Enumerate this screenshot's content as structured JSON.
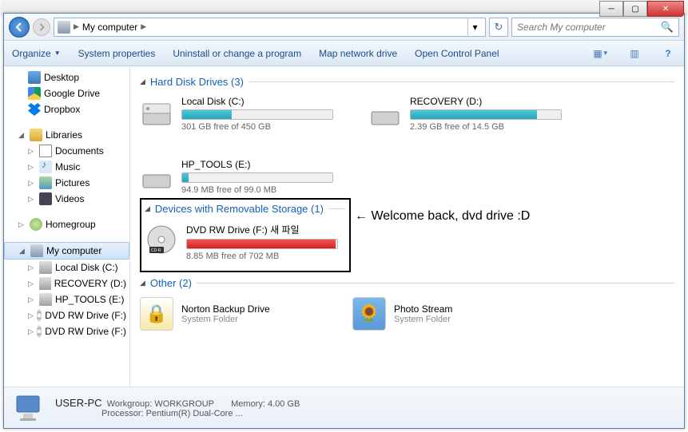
{
  "breadcrumb": {
    "location": "My computer"
  },
  "search": {
    "placeholder": "Search My computer"
  },
  "toolbar": {
    "organize": "Organize",
    "sysprops": "System properties",
    "uninstall": "Uninstall or change a program",
    "mapdrive": "Map network drive",
    "controlpanel": "Open Control Panel"
  },
  "sidebar": {
    "desktop": "Desktop",
    "gdrive": "Google Drive",
    "dropbox": "Dropbox",
    "libraries": "Libraries",
    "documents": "Documents",
    "music": "Music",
    "pictures": "Pictures",
    "videos": "Videos",
    "homegroup": "Homegroup",
    "mycomputer": "My computer",
    "local_c": "Local Disk (C:)",
    "recovery_d": "RECOVERY (D:)",
    "hptools_e": "HP_TOOLS (E:)",
    "dvd_f1": "DVD RW Drive (F:)",
    "dvd_f2": "DVD RW Drive (F:)"
  },
  "groups": {
    "hdd": "Hard Disk Drives (3)",
    "removable": "Devices with Removable Storage (1)",
    "other": "Other (2)"
  },
  "drives": {
    "c": {
      "name": "Local Disk (C:)",
      "free": "301 GB free of 450 GB",
      "pct": 33
    },
    "d": {
      "name": "RECOVERY (D:)",
      "free": "2.39 GB free of 14.5 GB",
      "pct": 84
    },
    "e": {
      "name": "HP_TOOLS (E:)",
      "free": "94.9 MB free of 99.0 MB",
      "pct": 4
    },
    "f": {
      "name": "DVD RW Drive (F:) 새 파일",
      "free": "8.85 MB free of 702 MB",
      "pct": 99
    }
  },
  "other_items": {
    "norton": {
      "name": "Norton Backup Drive",
      "sub": "System Folder"
    },
    "photostream": {
      "name": "Photo Stream",
      "sub": "System Folder"
    }
  },
  "annotation": {
    "arrow": "←",
    "text": "Welcome back, dvd drive :D"
  },
  "details": {
    "name": "USER-PC",
    "workgroup_label": "Workgroup:",
    "workgroup": "WORKGROUP",
    "memory_label": "Memory:",
    "memory": "4.00 GB",
    "processor_label": "Processor:",
    "processor": "Pentium(R) Dual-Core ..."
  }
}
